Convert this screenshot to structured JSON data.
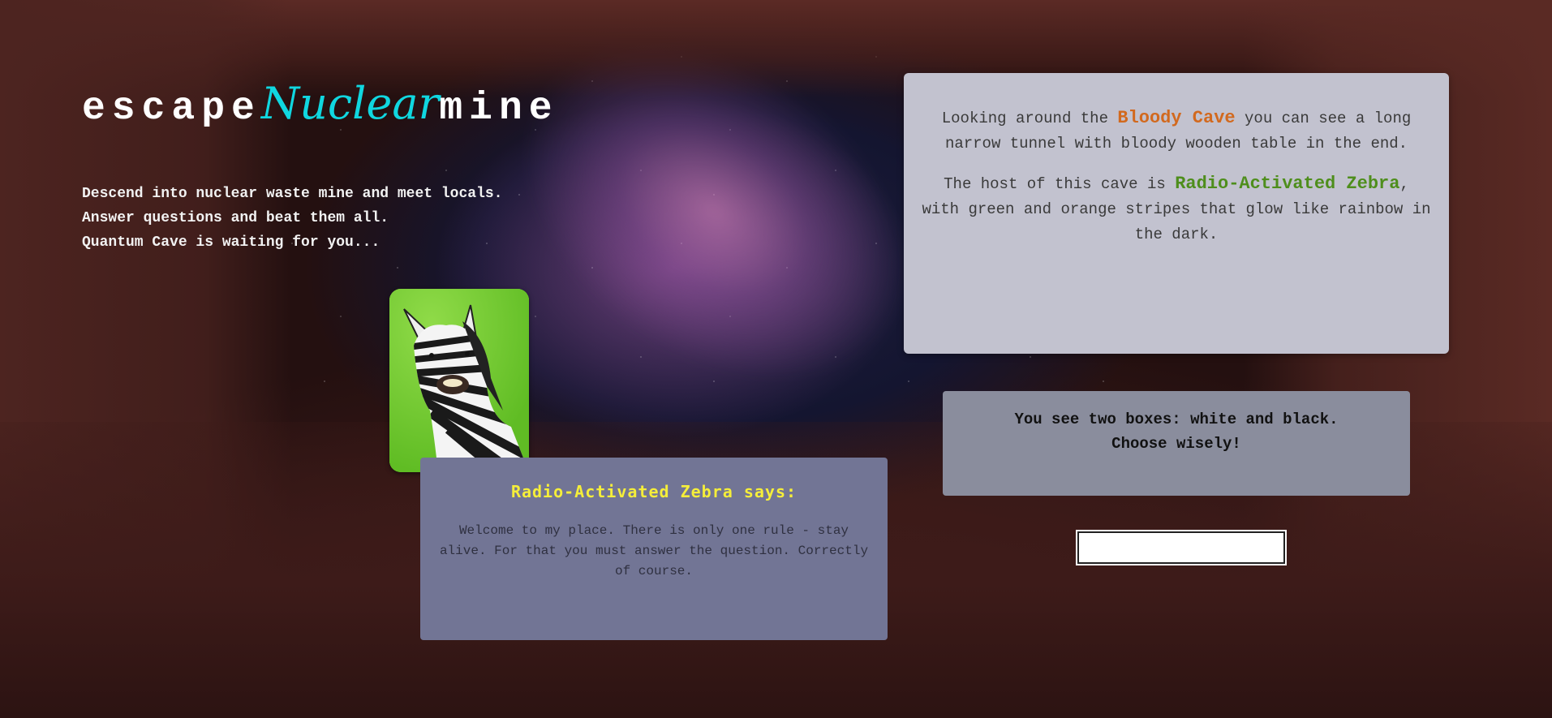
{
  "brand": {
    "prefix": "escape",
    "accent": "Nuclear",
    "suffix": "mine"
  },
  "intro": {
    "lines": [
      "Descend into nuclear waste mine and meet locals.",
      "Answer questions and beat them all.",
      "Quantum Cave is waiting for you..."
    ]
  },
  "avatar": {
    "alt": "Radio-Activated Zebra"
  },
  "speech": {
    "title": "Radio-Activated Zebra says:",
    "text": "Welcome to my place. There is only one rule - stay alive. For that you must answer the question. Correctly of course."
  },
  "description": {
    "p1_before": "Looking around the ",
    "p1_highlight": "Bloody Cave",
    "p1_after": " you can see a long narrow tunnel with bloody wooden table in the end.",
    "p2_before": "The host of this cave is ",
    "p2_highlight": "Radio-Activated Zebra",
    "p2_after": ", with green and orange stripes that glow like rainbow in the dark."
  },
  "prompt": {
    "line1": "You see two boxes: white and black.",
    "line2": "Choose wisely!"
  },
  "answer": {
    "value": "",
    "placeholder": ""
  },
  "colors": {
    "accent": "#10d7e0",
    "highlight_orange": "#d2691e",
    "highlight_green": "#4e8e1c",
    "speech_title": "#f5ee3a"
  }
}
